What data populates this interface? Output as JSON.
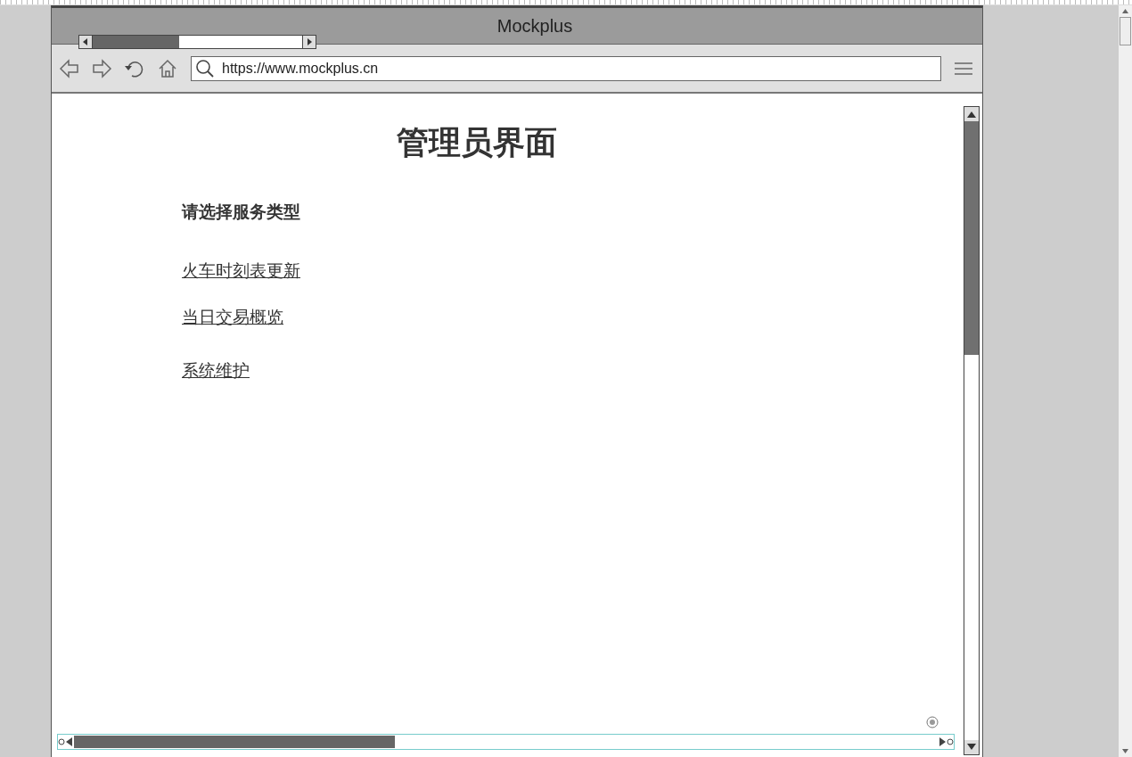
{
  "window": {
    "title": "Mockplus"
  },
  "address_bar": {
    "url": "https://www.mockplus.cn"
  },
  "page": {
    "heading": "管理员界面",
    "prompt": "请选择服务类型",
    "links": [
      {
        "label": "火车时刻表更新"
      },
      {
        "label": "当日交易概览"
      },
      {
        "label": "系统维护"
      }
    ]
  }
}
